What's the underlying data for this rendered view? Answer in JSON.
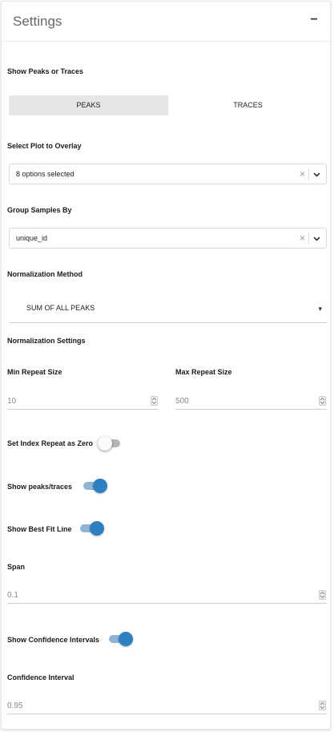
{
  "panel": {
    "title": "Settings",
    "collapse_symbol": "−"
  },
  "peaks_traces": {
    "label": "Show Peaks or Traces",
    "options": [
      "PEAKS",
      "TRACES"
    ],
    "selected": "PEAKS"
  },
  "plot_overlay": {
    "label": "Select Plot to Overlay",
    "value": "8 options selected"
  },
  "group_samples": {
    "label": "Group Samples By",
    "value": "unique_id"
  },
  "normalization_method": {
    "label": "Normalization Method",
    "value": "SUM OF ALL PEAKS"
  },
  "normalization_settings": {
    "heading": "Normalization Settings",
    "min_repeat": {
      "label": "Min Repeat Size",
      "value": "10"
    },
    "max_repeat": {
      "label": "Max Repeat Size",
      "value": "500"
    }
  },
  "index_repeat_zero": {
    "label": "Set Index Repeat as Zero",
    "on": false
  },
  "show_peaks_traces": {
    "label": "Show peaks/traces",
    "on": true
  },
  "show_best_fit": {
    "label": "Show Best Fit Line",
    "on": true
  },
  "span": {
    "label": "Span",
    "value": "0.1"
  },
  "show_confidence": {
    "label": "Show Confidence Intervals",
    "on": true
  },
  "confidence_interval": {
    "label": "Confidence Interval",
    "value": "0.95"
  },
  "colors": {
    "accent": "#2f80c0",
    "accent_track": "#8fb4d6",
    "active_tab": "#e6e6e6"
  },
  "icons": {
    "clear": "×",
    "dropdown": "chevron-down-icon",
    "caret": "▾"
  }
}
